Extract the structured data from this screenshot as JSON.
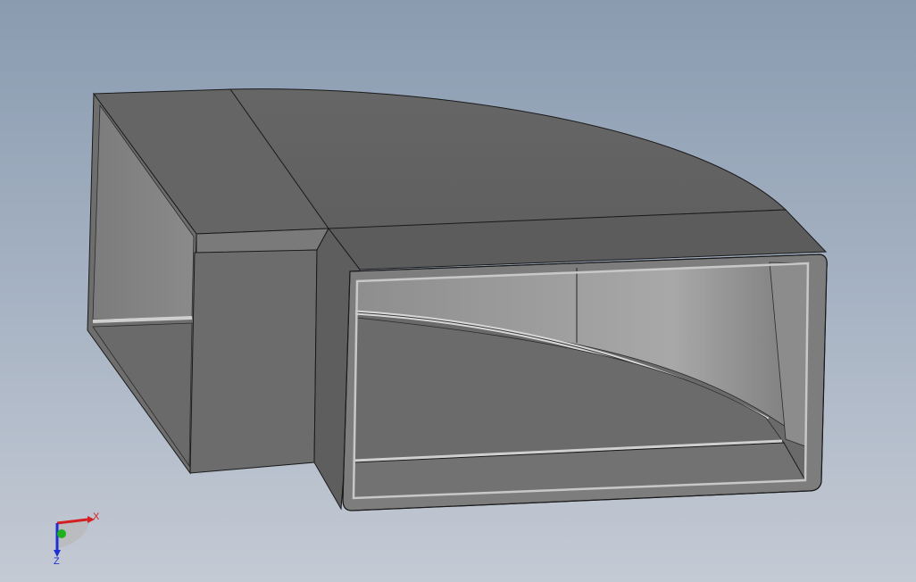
{
  "viewport": {
    "background_top": "#8a9bb0",
    "background_bottom": "#c4cad4"
  },
  "model": {
    "name": "duct-elbow-90",
    "body_color": "#6b6b6b",
    "inner_color": "#9a9a9a",
    "edge_color": "#1a1a1a"
  },
  "triad": {
    "x_label": "X",
    "z_label": "Z",
    "x_color": "#d42020",
    "y_color": "#20b020",
    "z_color": "#2030d0"
  }
}
